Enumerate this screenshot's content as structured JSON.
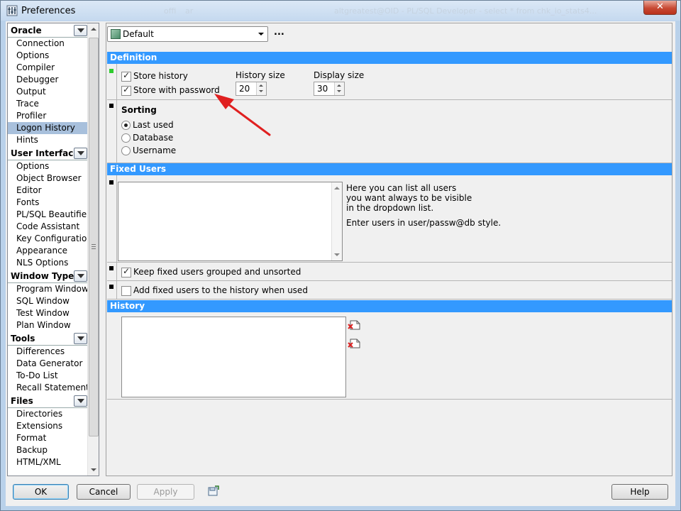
{
  "window": {
    "title": "Preferences",
    "background_titles": [
      "offi",
      "ar",
      "altgreatest@OID - PL/SQL Developer - select * from chk_io_stats4..."
    ]
  },
  "nav": {
    "sections": [
      {
        "label": "Oracle",
        "items": [
          "Connection",
          "Options",
          "Compiler",
          "Debugger",
          "Output",
          "Trace",
          "Profiler",
          "Logon History",
          "Hints"
        ]
      },
      {
        "label": "User Interface",
        "items": [
          "Options",
          "Object Browser",
          "Editor",
          "Fonts",
          "PL/SQL Beautifier",
          "Code Assistant",
          "Key Configuration",
          "Appearance",
          "NLS Options"
        ]
      },
      {
        "label": "Window Types",
        "items": [
          "Program Window",
          "SQL Window",
          "Test Window",
          "Plan Window"
        ]
      },
      {
        "label": "Tools",
        "items": [
          "Differences",
          "Data Generator",
          "To-Do List",
          "Recall Statement"
        ]
      },
      {
        "label": "Files",
        "items": [
          "Directories",
          "Extensions",
          "Format",
          "Backup",
          "HTML/XML"
        ]
      }
    ],
    "selected": "Logon History"
  },
  "profile": {
    "value": "Default",
    "more": "..."
  },
  "definition": {
    "header": "Definition",
    "store_history": "Store history",
    "store_with_password": "Store with password",
    "history_size_label": "History size",
    "history_size": "20",
    "display_size_label": "Display size",
    "display_size": "30"
  },
  "sorting": {
    "label": "Sorting",
    "options": [
      "Last used",
      "Database",
      "Username"
    ],
    "selected": "Last used"
  },
  "fixed_users": {
    "header": "Fixed Users",
    "help_line1": "Here you can list all users",
    "help_line2": "you want always to be visible",
    "help_line3": "in the dropdown list.",
    "help_line4": "Enter users in user/passw@db style.",
    "keep_grouped": "Keep fixed users grouped and unsorted",
    "add_to_history": "Add fixed users to the history when used"
  },
  "history": {
    "header": "History"
  },
  "buttons": {
    "ok": "OK",
    "cancel": "Cancel",
    "apply": "Apply",
    "help": "Help"
  },
  "colors": {
    "section_header": "#3399ff",
    "selection": "#a8c0dc",
    "annotation_arrow": "#e02020"
  }
}
